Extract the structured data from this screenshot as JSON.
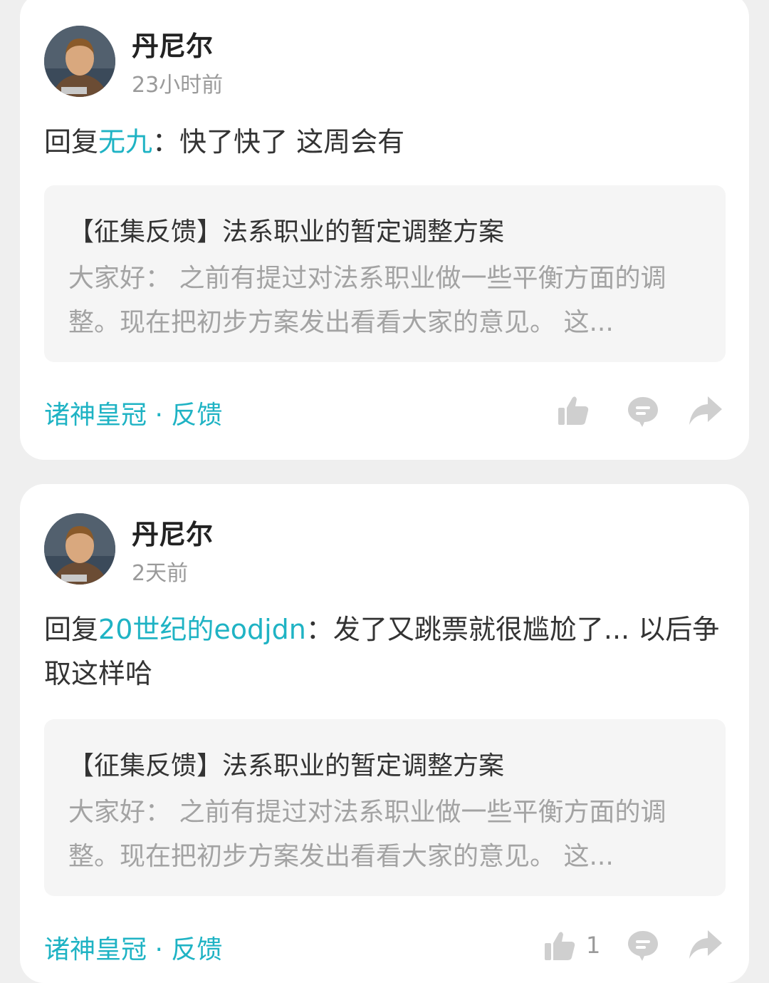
{
  "colors": {
    "accent": "#1fb3c4",
    "icon": "#cfcfcf",
    "background": "#efefef"
  },
  "posts": [
    {
      "author": "丹尼尔",
      "time": "23小时前",
      "reply_prefix": "回复",
      "reply_to": "无九",
      "reply_text": "：快了快了 这周会有",
      "quote_title": "【征集反馈】法系职业的暂定调整方案",
      "quote_body": "大家好： 之前有提过对法系职业做一些平衡方面的调整。现在把初步方案发出看看大家的意见。 这...",
      "source": "诸神皇冠 · 反馈",
      "like_count": "",
      "icons": [
        "thumbs-up-icon",
        "comment-icon",
        "share-icon"
      ]
    },
    {
      "author": "丹尼尔",
      "time": "2天前",
      "reply_prefix": "回复",
      "reply_to": "20世纪的eodjdn",
      "reply_text": "：发了又跳票就很尴尬了... 以后争取这样哈",
      "quote_title": "【征集反馈】法系职业的暂定调整方案",
      "quote_body": "大家好： 之前有提过对法系职业做一些平衡方面的调整。现在把初步方案发出看看大家的意见。 这...",
      "source": "诸神皇冠 · 反馈",
      "like_count": "1",
      "icons": [
        "thumbs-up-icon",
        "comment-icon",
        "share-icon"
      ]
    }
  ]
}
